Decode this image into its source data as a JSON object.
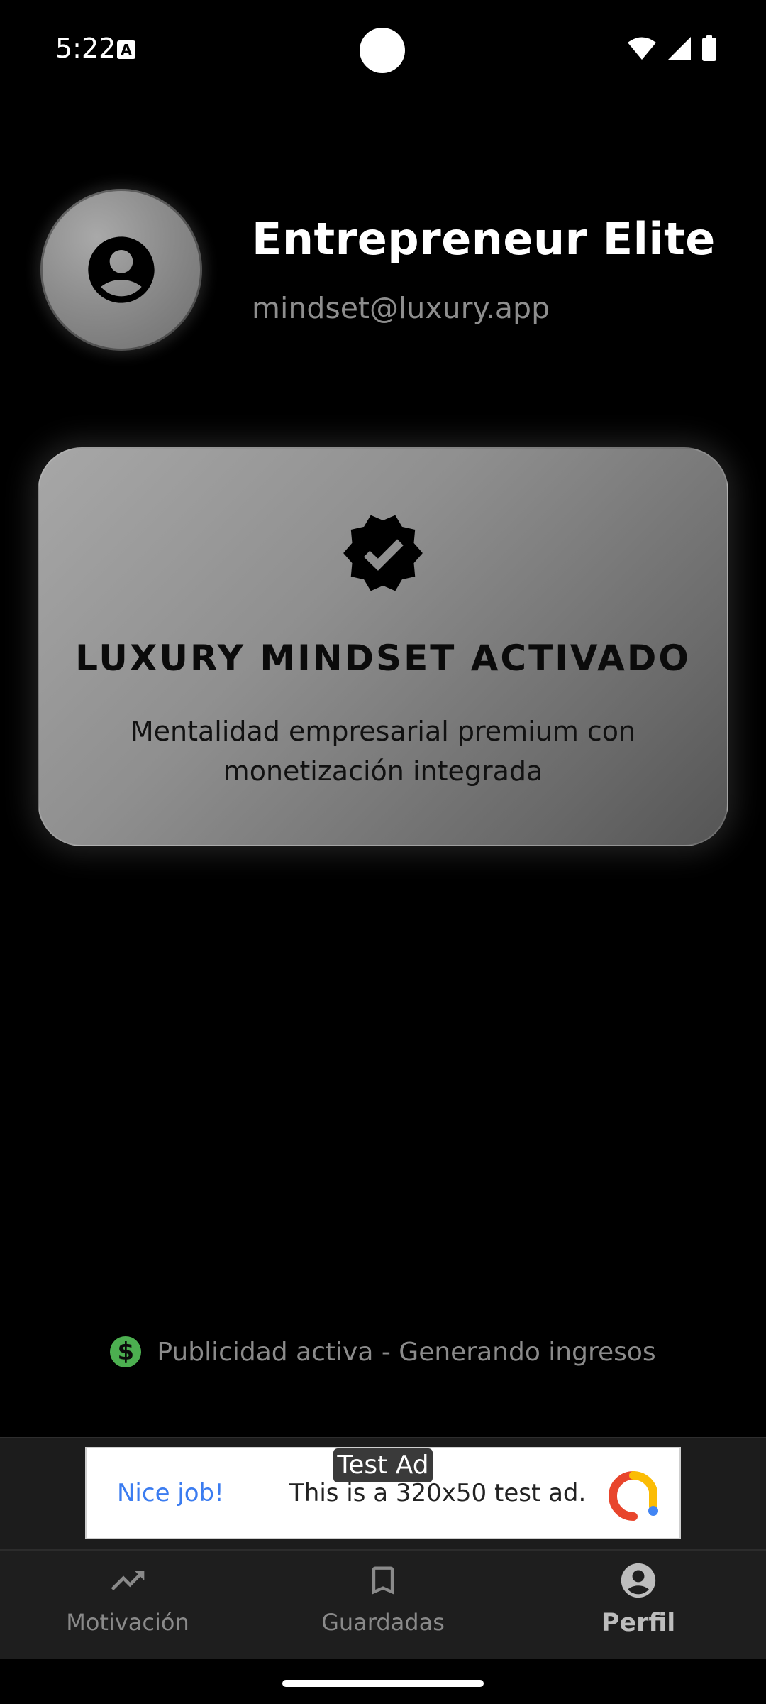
{
  "status_bar": {
    "time": "5:22",
    "notification_icon": "A"
  },
  "profile": {
    "name": "Entrepreneur Elite",
    "email": "mindset@luxury.app",
    "avatar_icon": "account-circle-icon"
  },
  "card": {
    "icon": "verified-badge-icon",
    "title": "LUXURY MINDSET ACTIVADO",
    "subtitle": "Mentalidad empresarial premium con monetización integrada"
  },
  "ads_status": {
    "icon": "dollar-icon",
    "text": "Publicidad activa - Generando ingresos",
    "icon_color": "#4caf50"
  },
  "ad_banner": {
    "label": "Test Ad",
    "headline": "Nice job!",
    "body": "This is a 320x50 test ad."
  },
  "bottom_nav": {
    "items": [
      {
        "label": "Motivación",
        "icon": "trending-up-icon",
        "active": false
      },
      {
        "label": "Guardadas",
        "icon": "bookmark-icon",
        "active": false
      },
      {
        "label": "Perfil",
        "icon": "person-icon",
        "active": true
      }
    ]
  },
  "colors": {
    "background": "#000000",
    "card_gradient_start": "#a7a7a7",
    "card_gradient_end": "#555555",
    "muted_text": "#8e8e8e"
  }
}
